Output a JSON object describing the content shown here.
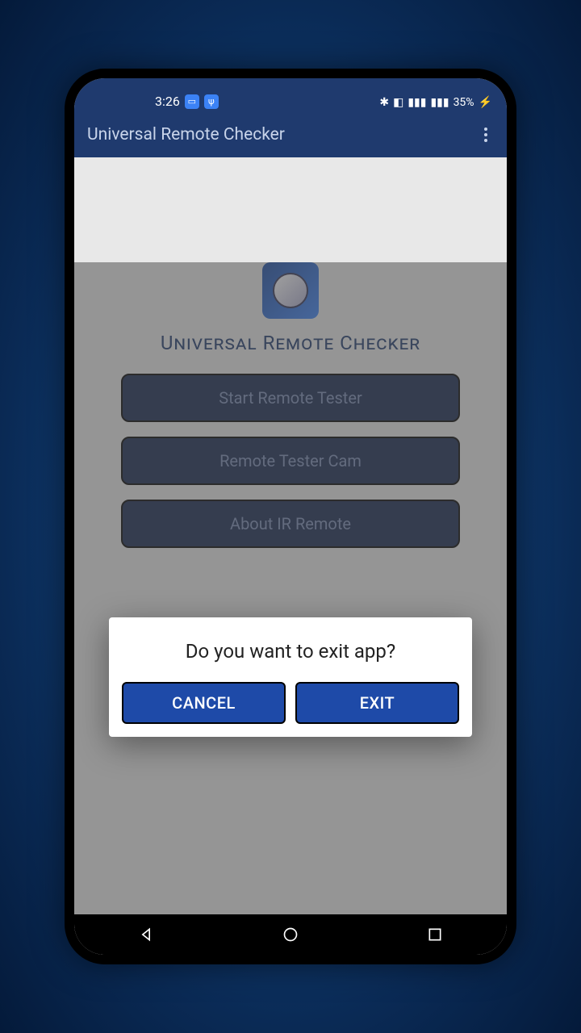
{
  "statusbar": {
    "time": "3:26",
    "battery_text": "35%"
  },
  "appbar": {
    "title": "Universal Remote Checker"
  },
  "main": {
    "title": "Universal Remote Checker",
    "buttons": [
      "Start Remote Tester",
      "Remote Tester Cam",
      "About IR Remote"
    ]
  },
  "dialog": {
    "message": "Do you want to exit app?",
    "cancel": "CANCEL",
    "exit": "EXIT"
  }
}
